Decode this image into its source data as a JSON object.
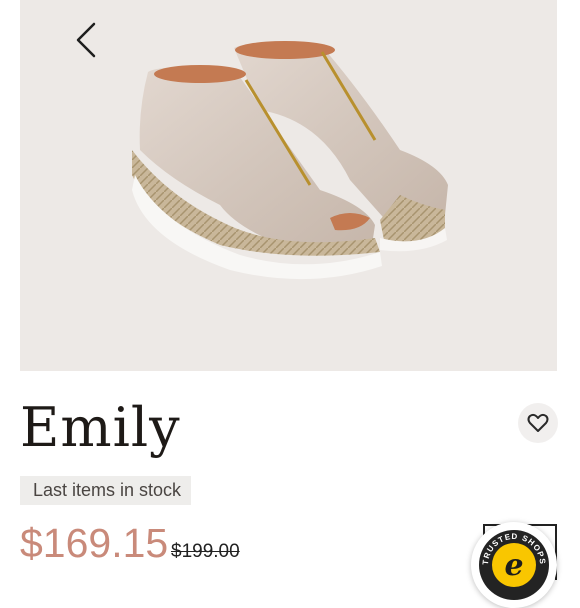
{
  "product": {
    "name": "Emily",
    "stock_status": "Last items in stock",
    "price": "$169.15",
    "old_price": "$199.00"
  },
  "icons": {
    "back": "chevron-left-icon",
    "wishlist": "heart-icon",
    "trust_badge": "trusted-shops-badge"
  },
  "trust_badge": {
    "text": "TRUSTED SHOPS",
    "mark": "e"
  },
  "colors": {
    "hero_bg": "#ede9e6",
    "price": "#c98a7a",
    "stock_bg": "#eeedeb",
    "badge_yellow": "#f9c600"
  }
}
